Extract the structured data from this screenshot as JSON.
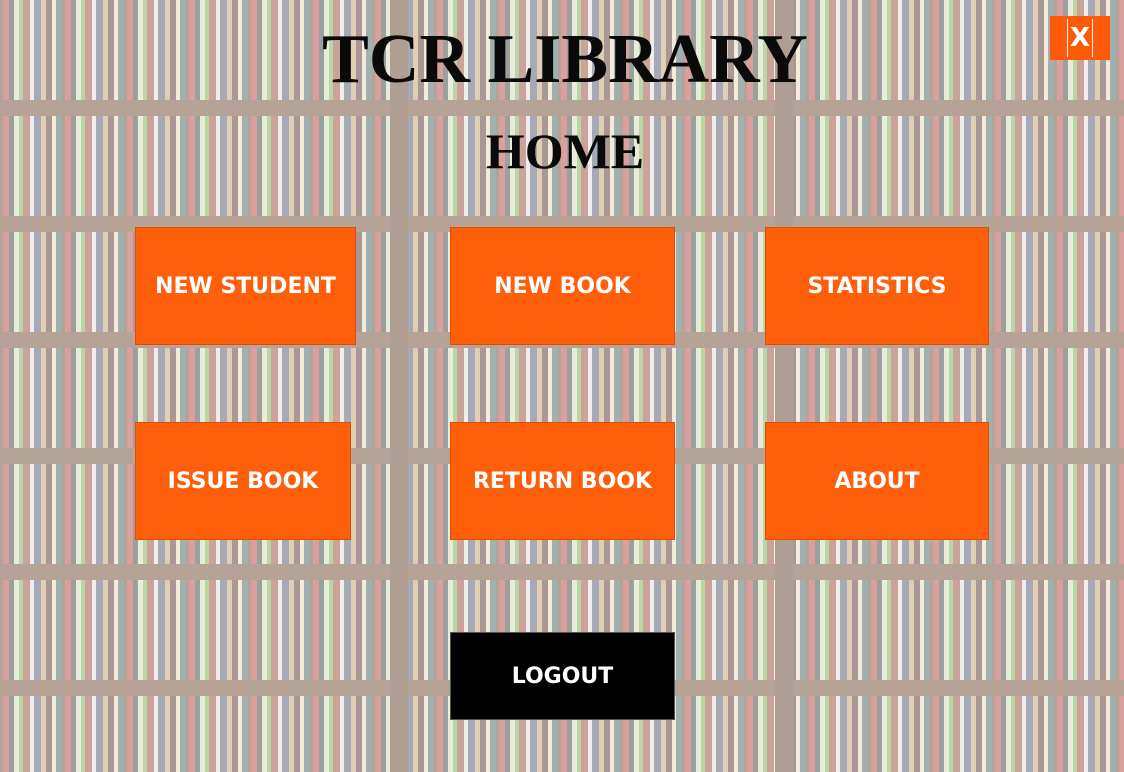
{
  "window": {
    "close_label": "X"
  },
  "header": {
    "title": "TCR LIBRARY",
    "subtitle": "HOME"
  },
  "menu": {
    "new_student": "NEW STUDENT",
    "new_book": "NEW BOOK",
    "statistics": "STATISTICS",
    "issue_book": "ISSUE BOOK",
    "return_book": "RETURN BOOK",
    "about": "ABOUT",
    "logout": "LOGOUT"
  },
  "colors": {
    "accent": "#ff5f0a",
    "logout_bg": "#000000",
    "text_on_accent": "#ffffff"
  }
}
